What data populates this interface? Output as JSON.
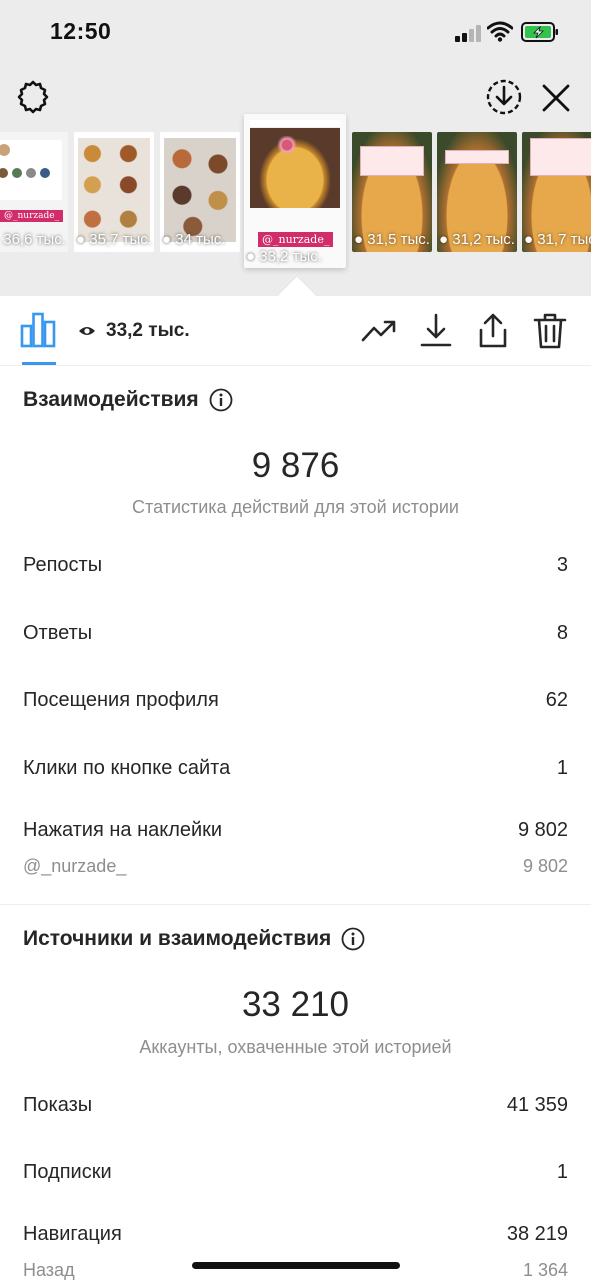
{
  "status_bar": {
    "time": "12:50"
  },
  "viewer": {
    "icons": {
      "settings": "settings-gear-icon",
      "save": "download-circle-icon",
      "close": "close-icon"
    },
    "thumbnails": [
      {
        "views": "36,6 тыс."
      },
      {
        "views": "35,7 тыс."
      },
      {
        "views": "34 тыс."
      },
      {
        "views": "33,2 тыс.",
        "sticker": "@_nurzade_",
        "selected": true
      },
      {
        "views": "31,5 тыс."
      },
      {
        "views": "31,2 тыс."
      },
      {
        "views": "31,7 тыс."
      }
    ],
    "thumb0_sticker": "@_nurzade_"
  },
  "toolbar": {
    "views": "33,2 тыс.",
    "icons": [
      "insights-bar-chart-icon",
      "eye-icon",
      "trend-arrow-icon",
      "download-icon",
      "share-icon",
      "trash-icon"
    ],
    "accent_color": "#3897f0"
  },
  "interactions": {
    "title": "Взаимодействия",
    "total": "9 876",
    "subtitle": "Статистика действий для этой истории",
    "rows": [
      {
        "label": "Репосты",
        "value": "3"
      },
      {
        "label": "Ответы",
        "value": "8"
      },
      {
        "label": "Посещения профиля",
        "value": "62"
      },
      {
        "label": "Клики по кнопке сайта",
        "value": "1"
      },
      {
        "label": "Нажатия на наклейки",
        "value": "9 802"
      }
    ],
    "sticker_row": {
      "label": "@_nurzade_",
      "value": "9 802"
    }
  },
  "discovery": {
    "title": "Источники и взаимодействия",
    "total": "33 210",
    "subtitle": "Аккаунты, охваченные этой историей",
    "rows": [
      {
        "label": "Показы",
        "value": "41 359"
      },
      {
        "label": "Подписки",
        "value": "1"
      },
      {
        "label": "Навигация",
        "value": "38 219"
      }
    ],
    "sub_row": {
      "label": "Назад",
      "value": "1 364"
    }
  }
}
